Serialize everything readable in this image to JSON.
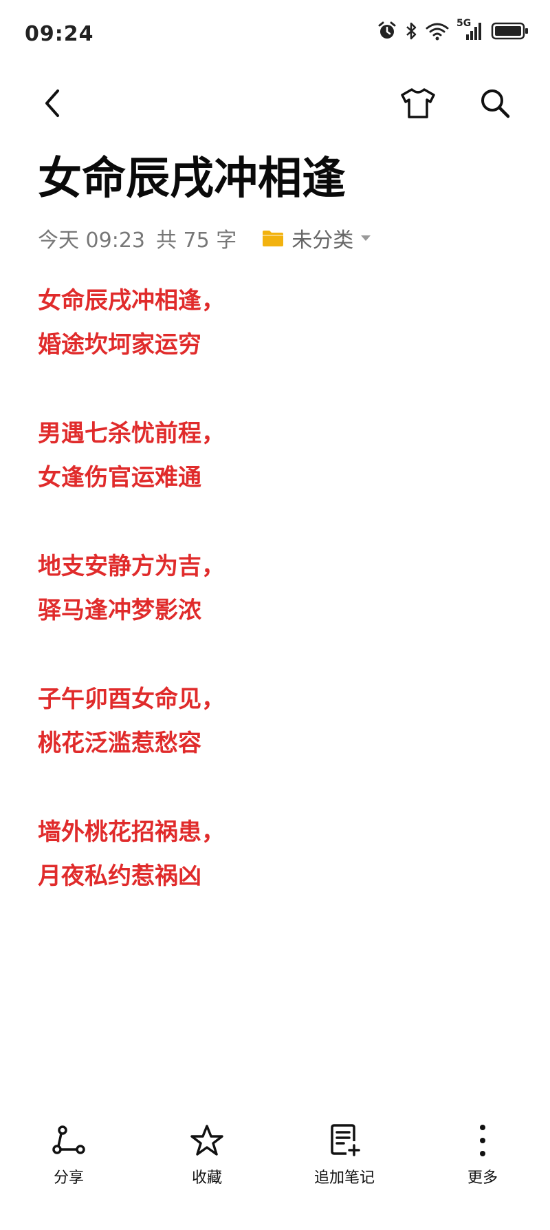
{
  "status_bar": {
    "time": "09:24",
    "network_label": "5G",
    "icons": [
      "alarm-icon",
      "bluetooth-icon",
      "wifi-icon",
      "signal-icon",
      "battery-icon"
    ]
  },
  "nav": {
    "back_icon": "chevron-left-icon",
    "theme_icon": "tshirt-icon",
    "search_icon": "search-icon"
  },
  "note": {
    "title": "女命辰戌冲相逢",
    "meta": {
      "date": "今天 09:23",
      "word_count": "共 75 字",
      "folder": "未分类"
    },
    "stanzas": [
      [
        "女命辰戌冲相逢，",
        "婚途坎坷家运穷"
      ],
      [
        "男遇七杀忧前程，",
        "女逢伤官运难通"
      ],
      [
        "地支安静方为吉，",
        "驿马逢冲梦影浓"
      ],
      [
        "子午卯酉女命见，",
        "桃花泛滥惹愁容"
      ],
      [
        "墙外桃花招祸患，",
        "月夜私约惹祸凶"
      ]
    ],
    "text_color": "#e02b2b",
    "folder_color": "#f2b20f"
  },
  "toolbar": {
    "share_label": "分享",
    "favorite_label": "收藏",
    "append_label": "追加笔记",
    "more_label": "更多"
  }
}
